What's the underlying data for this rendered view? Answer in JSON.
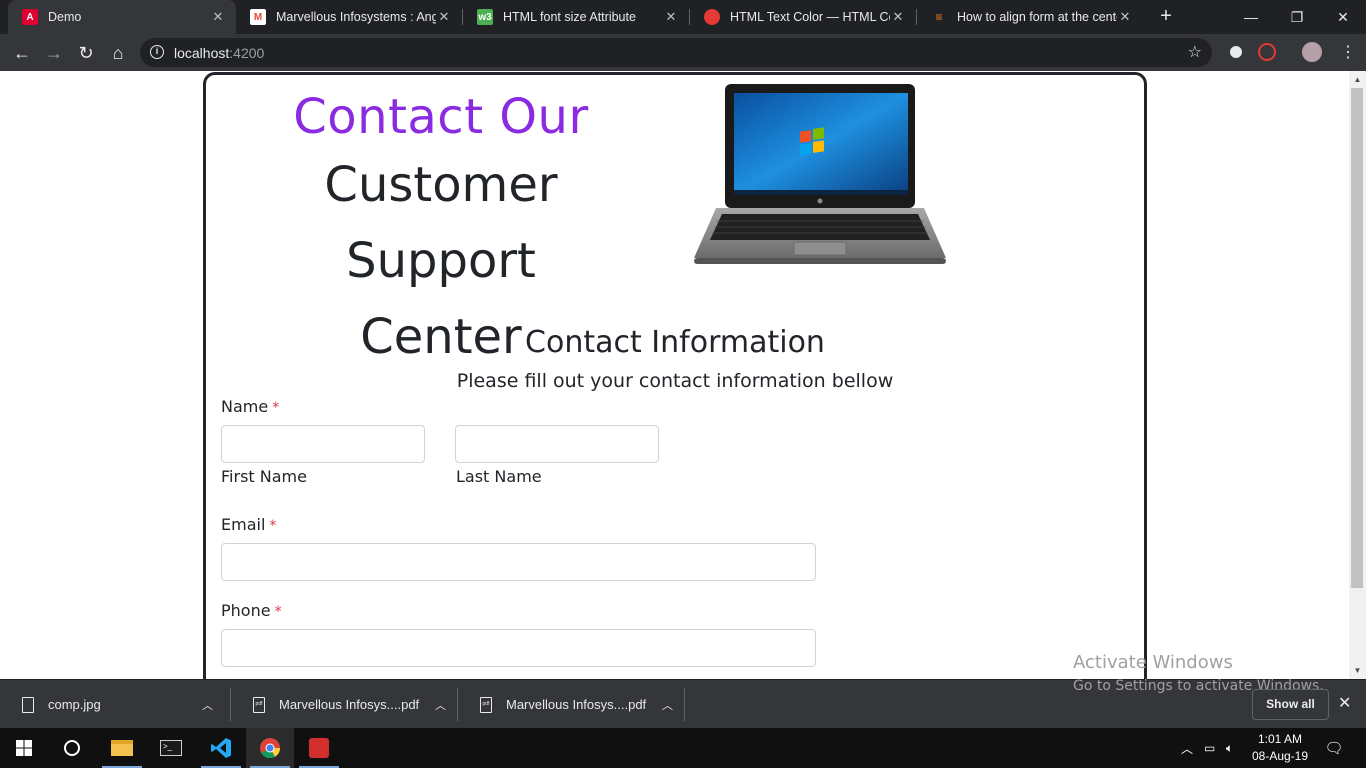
{
  "browser": {
    "tabs": [
      {
        "title": "Demo",
        "icon": "angular-icon",
        "color": "#dd0031",
        "active": true
      },
      {
        "title": "Marvellous Infosystems : Angu",
        "icon": "gmail-icon",
        "color": "#ea4335",
        "active": false
      },
      {
        "title": "HTML font size Attribute",
        "icon": "w3-icon",
        "color": "#4caf50",
        "active": false
      },
      {
        "title": "HTML Text Color — HTML Colo",
        "icon": "htmlcolor-icon",
        "color": "#e53935",
        "active": false
      },
      {
        "title": "How to align form at the cente",
        "icon": "stackoverflow-icon",
        "color": "#f48024",
        "active": false
      }
    ],
    "address": {
      "host": "localhost",
      "port": ":4200"
    }
  },
  "page": {
    "heading_accent": "Contact Our",
    "heading_line2": "Customer Support",
    "heading_line3": "Center",
    "section_title": "Contact Information",
    "section_subtitle": "Please fill out your contact information bellow",
    "form": {
      "name_label": "Name",
      "first_name_label": "First Name",
      "last_name_label": "Last Name",
      "email_label": "Email",
      "phone_label": "Phone",
      "required_mark": "*",
      "first_name_value": "",
      "last_name_value": "",
      "email_value": "",
      "phone_value": ""
    },
    "accent_color": "#8a2be2"
  },
  "watermark": {
    "line1": "Activate Windows",
    "line2": "Go to Settings to activate Windows."
  },
  "downloads": {
    "items": [
      {
        "name": "comp.jpg"
      },
      {
        "name": "Marvellous Infosys....pdf"
      },
      {
        "name": "Marvellous Infosys....pdf"
      }
    ],
    "show_all": "Show all"
  },
  "taskbar": {
    "time": "1:01 AM",
    "date": "08-Aug-19"
  }
}
